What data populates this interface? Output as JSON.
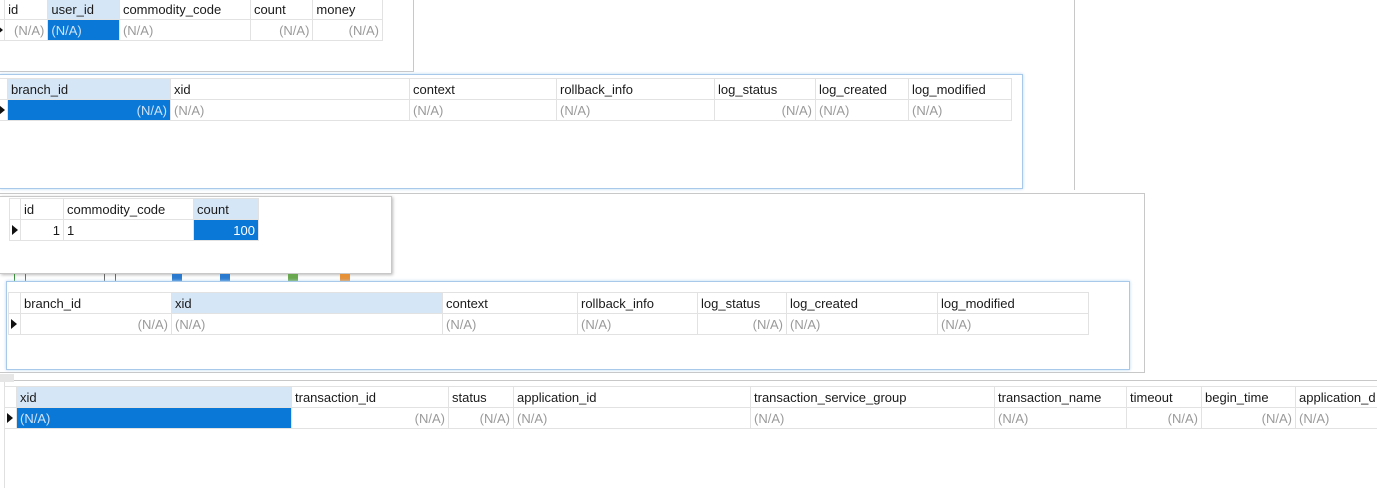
{
  "grid1": {
    "columns": [
      "id",
      "user_id",
      "commodity_code",
      "count",
      "money"
    ],
    "row": [
      "(N/A)",
      "(N/A)",
      "(N/A)",
      "(N/A)",
      "(N/A)"
    ]
  },
  "grid2": {
    "columns": [
      "branch_id",
      "xid",
      "context",
      "rollback_info",
      "log_status",
      "log_created",
      "log_modified"
    ],
    "row": [
      "(N/A)",
      "(N/A)",
      "(N/A)",
      "(N/A)",
      "(N/A)",
      "(N/A)",
      "(N/A)"
    ]
  },
  "grid3": {
    "columns": [
      "id",
      "commodity_code",
      "count"
    ],
    "row": [
      "1",
      "1",
      "100"
    ]
  },
  "grid4": {
    "columns": [
      "branch_id",
      "xid",
      "context",
      "rollback_info",
      "log_status",
      "log_created",
      "log_modified"
    ],
    "row": [
      "(N/A)",
      "(N/A)",
      "(N/A)",
      "(N/A)",
      "(N/A)",
      "(N/A)",
      "(N/A)"
    ]
  },
  "grid5": {
    "columns": [
      "xid",
      "transaction_id",
      "status",
      "application_id",
      "transaction_service_group",
      "transaction_name",
      "timeout",
      "begin_time",
      "application_d"
    ],
    "row": [
      "(N/A)",
      "(N/A)",
      "(N/A)",
      "(N/A)",
      "(N/A)",
      "(N/A)",
      "(N/A)",
      "(N/A)",
      "(N/A)"
    ]
  },
  "colors": {
    "selection": "#0a78d7",
    "selected_header": "#d5e6f7",
    "null_text": "#9a9a9a"
  }
}
